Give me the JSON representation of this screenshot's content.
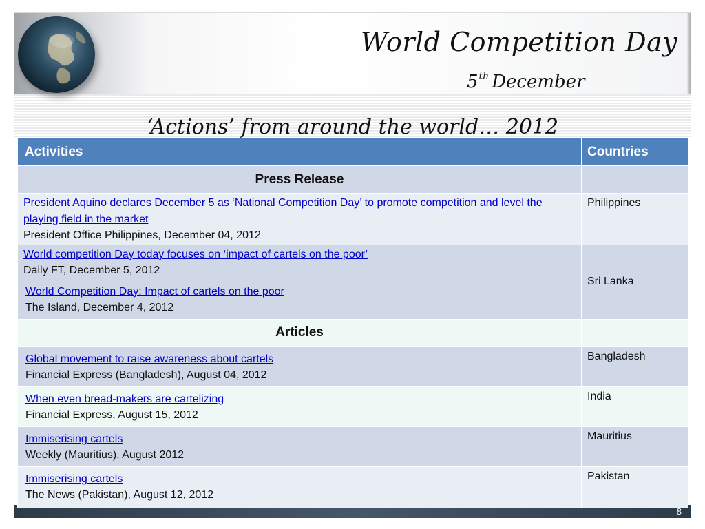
{
  "slide": {
    "title": "World Competition Day",
    "subtitle_day": "5",
    "subtitle_suffix": "th",
    "subtitle_month": "December",
    "section_heading": "‘Actions’ from around the world… 2012",
    "page_number": "8"
  },
  "table": {
    "headers": {
      "activities": "Activities",
      "countries": "Countries"
    },
    "sections": [
      {
        "label": "Press Release",
        "items": [
          {
            "headline": "President Aquino declares December 5 as ‘National Competition Day’ to promote competition and level the playing field in the market",
            "source": "President Office Philippines, December 04, 2012",
            "country": "Philippines"
          },
          {
            "headline": "World competition Day today focuses on ‘impact of cartels on the poor’",
            "source": "Daily FT, December 5, 2012",
            "country": "Sri Lanka"
          },
          {
            "headline": "World Competition Day: Impact of cartels on the poor",
            "source": "The Island, December 4, 2012",
            "country": "Sri Lanka"
          }
        ]
      },
      {
        "label": "Articles",
        "items": [
          {
            "headline": "Global movement to raise awareness about cartels",
            "source": "Financial Express (Bangladesh), August 04, 2012",
            "country": "Bangladesh"
          },
          {
            "headline": "When even bread-makers are cartelizing",
            "source": "Financial Express, August 15, 2012",
            "country": "India"
          },
          {
            "headline": "Immiserising cartels",
            "source": "Weekly (Mauritius), August 2012",
            "country": "Mauritius"
          },
          {
            "headline": "Immiserising cartels",
            "source": "The News (Pakistan),  August 12, 2012",
            "country": "Pakistan"
          }
        ]
      }
    ]
  },
  "colors": {
    "header_fill": "#4f81bd",
    "row_dark": "#d0d8e8",
    "row_light": "#e9edf4",
    "link": "#0000cc"
  },
  "icons": {
    "logo": "globe-icon"
  }
}
